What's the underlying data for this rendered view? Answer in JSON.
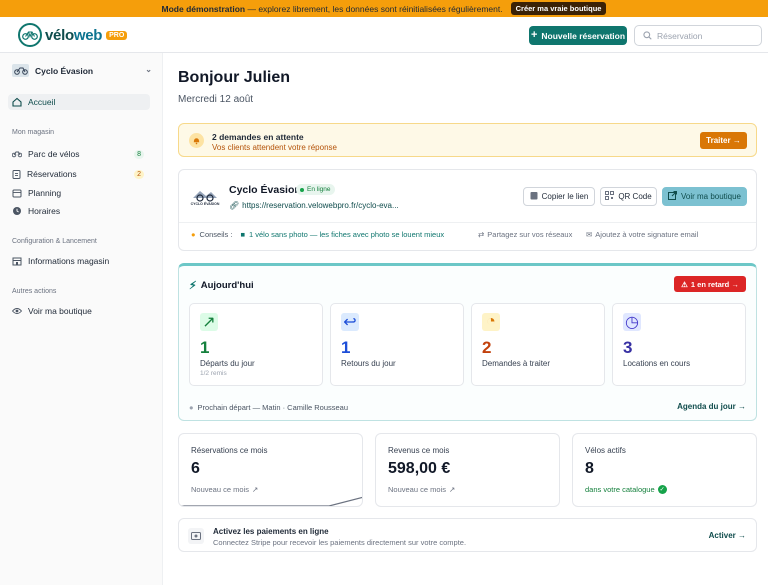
{
  "banner": {
    "mode": "Mode démonstration",
    "message": " — explorez librement, les données sont réinitialisées régulièrement.",
    "cta": "Créer ma vraie boutique"
  },
  "header": {
    "logo_part1": "vélo",
    "logo_part2": "web",
    "logo_badge": "PRO",
    "new_reservation": "Nouvelle réservation",
    "search_placeholder": "Réservation"
  },
  "sidebar": {
    "shop_name": "Cyclo Évasion",
    "home": "Accueil",
    "section_shop": "Mon magasin",
    "fleet": "Parc de vélos",
    "fleet_count": "8",
    "reservations": "Réservations",
    "reservations_count": "2",
    "planning": "Planning",
    "hours": "Horaires",
    "section_config": "Configuration & Lancement",
    "shop_info": "Informations magasin",
    "section_other": "Autres actions",
    "view_shop": "Voir ma boutique"
  },
  "main": {
    "greeting": "Bonjour Julien",
    "date": "Mercredi 12 août",
    "pending": {
      "title": "2 demandes en attente",
      "subtitle": "Vos clients attendent votre réponse",
      "button": "Traiter →"
    },
    "shop": {
      "name": "Cyclo Évasion",
      "status": "En ligne",
      "url": "https://reservation.velowebpro.fr/cyclo-eva...",
      "logo_text": "CYCLO ÉVASION",
      "copy_link": "Copier le lien",
      "qr": "QR Code",
      "view_shop": "Voir ma boutique",
      "tips_label": "Conseils :",
      "tip1": "1 vélo sans photo — les fiches avec photo se louent mieux",
      "tip2": "Partagez sur vos réseaux",
      "tip3": "Ajoutez à votre signature email"
    },
    "today": {
      "title": "Aujourd'hui",
      "late": "1 en retard →",
      "stats": [
        {
          "value": "1",
          "label": "Départs du jour",
          "sub": "1/2 remis"
        },
        {
          "value": "1",
          "label": "Retours du jour",
          "sub": ""
        },
        {
          "value": "2",
          "label": "Demandes à traiter",
          "sub": ""
        },
        {
          "value": "3",
          "label": "Locations en cours",
          "sub": ""
        }
      ],
      "next": "Prochain départ — Matin · Camille Rousseau",
      "agenda": "Agenda du jour →"
    },
    "kpis": [
      {
        "label": "Réservations ce mois",
        "value": "6",
        "sub": "Nouveau ce mois"
      },
      {
        "label": "Revenus ce mois",
        "value": "598,00 €",
        "sub": "Nouveau ce mois"
      },
      {
        "label": "Vélos actifs",
        "value": "8",
        "sub": "dans votre catalogue"
      }
    ],
    "stripe": {
      "title": "Activez les paiements en ligne",
      "subtitle": "Connectez Stripe pour recevoir les paiements directement sur votre compte.",
      "action": "Activer →"
    }
  },
  "colors": {
    "brand": "#0f766e",
    "warning": "#d97706",
    "danger": "#dc2626",
    "banner": "#f59e0b"
  }
}
